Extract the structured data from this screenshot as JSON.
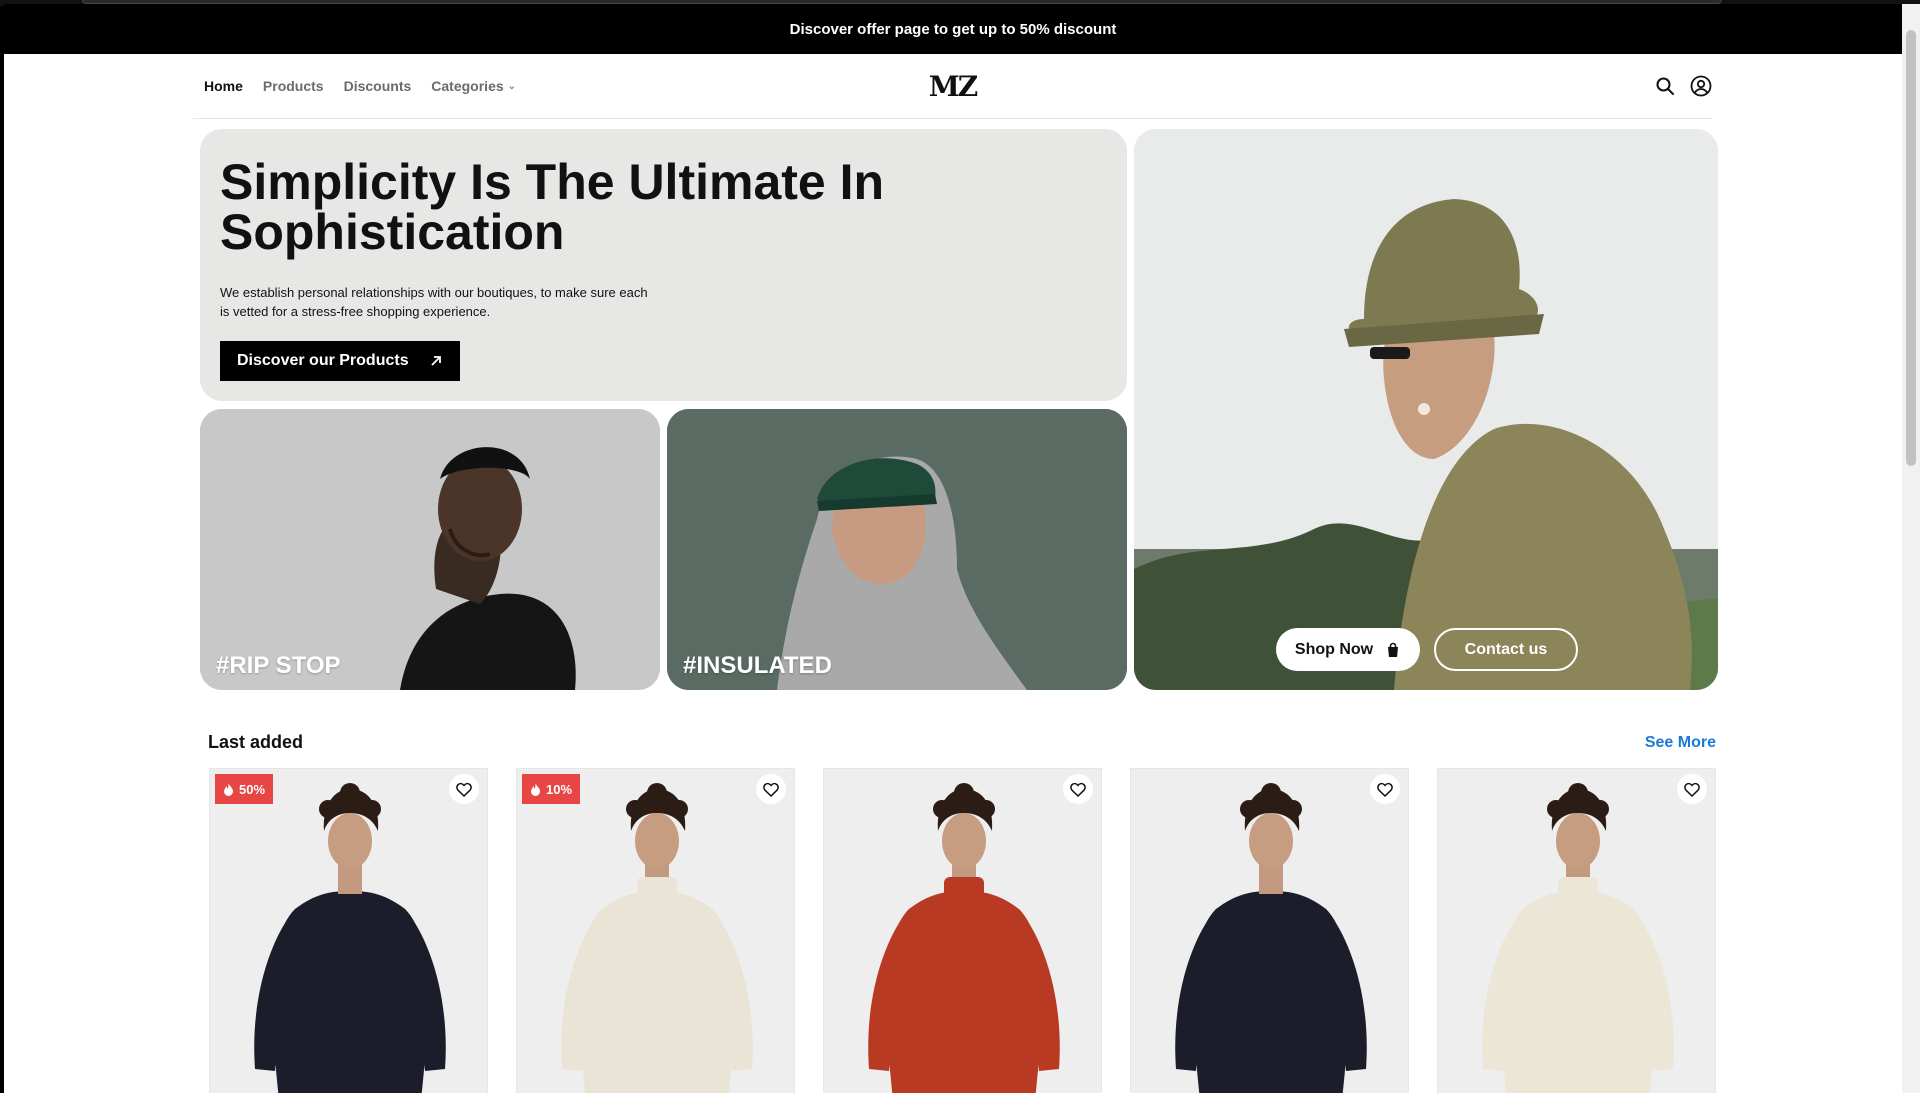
{
  "announcement": "Discover offer page to get up to 50% discount",
  "nav": {
    "links": [
      "Home",
      "Products",
      "Discounts",
      "Categories"
    ],
    "logo": "MZ",
    "icons": [
      "search-icon",
      "user-icon"
    ]
  },
  "hero": {
    "title": "Simplicity Is The Ultimate In Sophistication",
    "description": "We establish personal relationships with our boutiques, to make sure each is vetted for a stress-free shopping experience.",
    "cta_label": "Discover our Products",
    "tiles": [
      "#RIP STOP",
      "#INSULATED"
    ],
    "shop_now": "Shop Now",
    "contact": "Contact us"
  },
  "last_added": {
    "heading": "Last added",
    "see_more": "See More",
    "products": [
      {
        "badge": "50%",
        "sweater_color": "#1b1d2a",
        "neck": "crew"
      },
      {
        "badge": "10%",
        "sweater_color": "#e9e4d6",
        "neck": "turtle"
      },
      {
        "badge": "",
        "sweater_color": "#b83a22",
        "neck": "turtle"
      },
      {
        "badge": "",
        "sweater_color": "#1b1d2a",
        "neck": "crew"
      },
      {
        "badge": "",
        "sweater_color": "#ece6d6",
        "neck": "turtle"
      }
    ]
  },
  "colors": {
    "accent_link": "#1a7ad6",
    "badge_red": "#e84545",
    "hero_bg": "#e7e8e6"
  }
}
